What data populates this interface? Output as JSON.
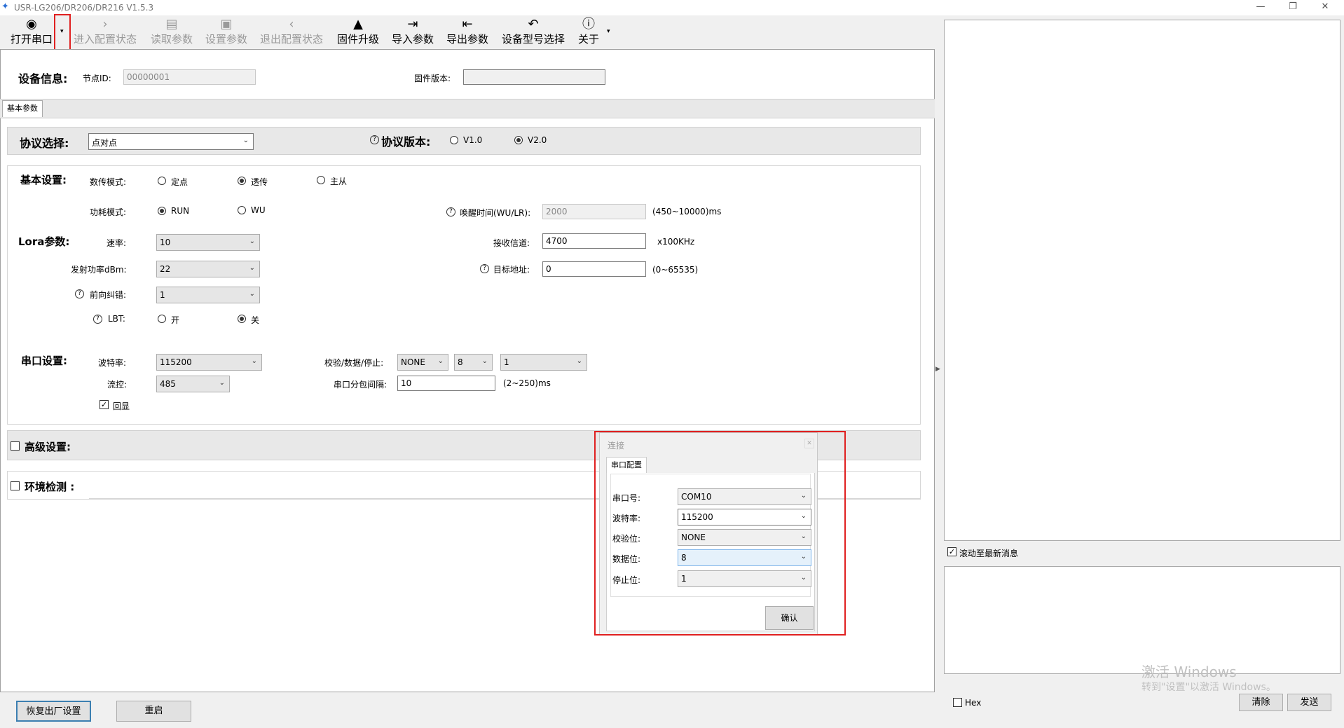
{
  "app": {
    "title": "USR-LG206/DR206/DR216 V1.5.3"
  },
  "toolbar": {
    "open_port": "打开串口",
    "enter_config": "进入配置状态",
    "read_params": "读取参数",
    "set_params": "设置参数",
    "exit_config": "退出配置状态",
    "firmware": "固件升级",
    "import": "导入参数",
    "export": "导出参数",
    "model_select": "设备型号选择",
    "about": "关于"
  },
  "device": {
    "heading": "设备信息:",
    "node_id_label": "节点ID:",
    "node_id": "00000001",
    "fw_label": "固件版本:",
    "fw_value": ""
  },
  "tabs": {
    "basic": "基本参数"
  },
  "protocol": {
    "label": "协议选择:",
    "value": "点对点",
    "version_label": "协议版本:",
    "v1": "V1.0",
    "v2": "V2.0"
  },
  "basic": {
    "heading": "基本设置:",
    "mode_label": "数传模式:",
    "mode_fixed": "定点",
    "mode_trans": "透传",
    "mode_ms": "主从",
    "power_label": "功耗模式:",
    "power_run": "RUN",
    "power_wu": "WU",
    "wake_label": "唤醒时间(WU/LR):",
    "wake_value": "2000",
    "wake_range": "(450~10000)ms"
  },
  "lora": {
    "heading": "Lora参数:",
    "rate_label": "速率:",
    "rate": "10",
    "rx_label": "接收信道:",
    "rx": "4700",
    "rx_unit": "x100KHz",
    "txp_label": "发射功率dBm:",
    "txp": "22",
    "target_label": "目标地址:",
    "target": "0",
    "target_range": "(0~65535)",
    "fec_label": "前向纠错:",
    "fec": "1",
    "lbt_label": "LBT:",
    "lbt_on": "开",
    "lbt_off": "关"
  },
  "serial": {
    "heading": "串口设置:",
    "baud_label": "波特率:",
    "baud": "115200",
    "check_label": "校验/数据/停止:",
    "parity": "NONE",
    "data": "8",
    "stop": "1",
    "flow_label": "流控:",
    "flow": "485",
    "interval_label": "串口分包间隔:",
    "interval": "10",
    "interval_range": "(2~250)ms",
    "echo": "回显"
  },
  "advanced": {
    "label": "高级设置:"
  },
  "env": {
    "label": "环境检测 :"
  },
  "bottom": {
    "factory": "恢复出厂设置",
    "restart": "重启"
  },
  "dialog": {
    "title": "连接",
    "tab": "串口配置",
    "port_label": "串口号:",
    "port": "COM10",
    "baud_label": "波特率:",
    "baud": "115200",
    "parity_label": "校验位:",
    "parity": "NONE",
    "data_label": "数据位:",
    "data": "8",
    "stop_label": "停止位:",
    "stop": "1",
    "ok": "确认"
  },
  "right": {
    "scroll": "滚动至最新消息",
    "hex": "Hex",
    "clear": "清除",
    "send": "发送"
  },
  "watermark": {
    "line1": "激活 Windows",
    "line2": "转到\"设置\"以激活 Windows。"
  },
  "colors": {
    "highlight": "#e02020"
  }
}
